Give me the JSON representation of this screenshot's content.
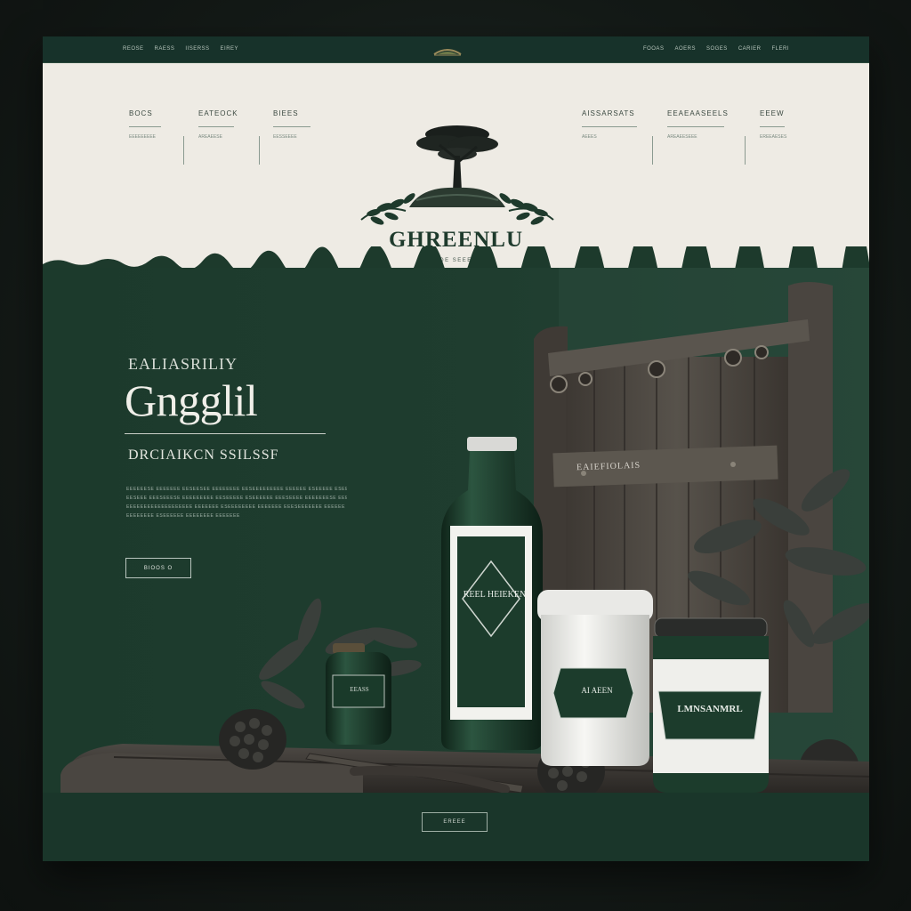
{
  "topnav": {
    "left_links": [
      "REOSE",
      "RAESS",
      "IISERSS",
      "EIREY"
    ],
    "right_links": [
      "FOOAS",
      "AOERS",
      "SOGES",
      "CARIER",
      "FLERI"
    ]
  },
  "header": {
    "menu_left": [
      {
        "label": "BOCS",
        "sub": "EEEEEEEEE"
      },
      {
        "label": "EATEOCK",
        "sub": "AREAEESE"
      },
      {
        "label": "BIEES",
        "sub": "EESSEEEE"
      }
    ],
    "menu_right": [
      {
        "label": "AISSARSATS",
        "sub": "AEEES"
      },
      {
        "label": "EEAEAASEELS",
        "sub": "AREAEESEEE"
      },
      {
        "label": "EEEW",
        "sub": "EREEAESES"
      }
    ],
    "brand_name": "GHREENLU",
    "brand_tagline": "BEEDE SEEEEEB"
  },
  "hero": {
    "eyebrow": "EALIASRILIY",
    "title": "Gngglil",
    "subtitle": "DRCIAIKCN SSILSSF",
    "paragraph": [
      "EEEEEESE EEEEEEE EESEESEE EEEEEEEE EESEEEEEEEEE EEEEEE ESEEEEE ESEEEEE EE",
      "EESEEE EEESEEESE EEEEEEEEE EESEEEEE ESEEEEEE EEESEEEE EEEEEEESE EEEEE EEE",
      "EEEEEEEEEEEEEEEEEEE EEEEEEE ESEEEEEEEE EEEEEEE EEESEEEEEEE EEEEEE EEEEE",
      "EEEEEEEE ESEEEEEE EEEEEEEE EEEEEEE"
    ],
    "cta_label": "BIOOS O",
    "shelf_label": "EAIEFIOLAIS",
    "bottle_label": "REEL HEIEKEN",
    "jar_small_label": "EEASS",
    "tub_label": "AI AEEN",
    "jar_label": "LMNSANMRL"
  },
  "footer": {
    "button_label": "EREEE"
  },
  "colors": {
    "brand_green": "#1d3a2c",
    "cream": "#eeebe4",
    "dark_bg": "#141a17"
  }
}
